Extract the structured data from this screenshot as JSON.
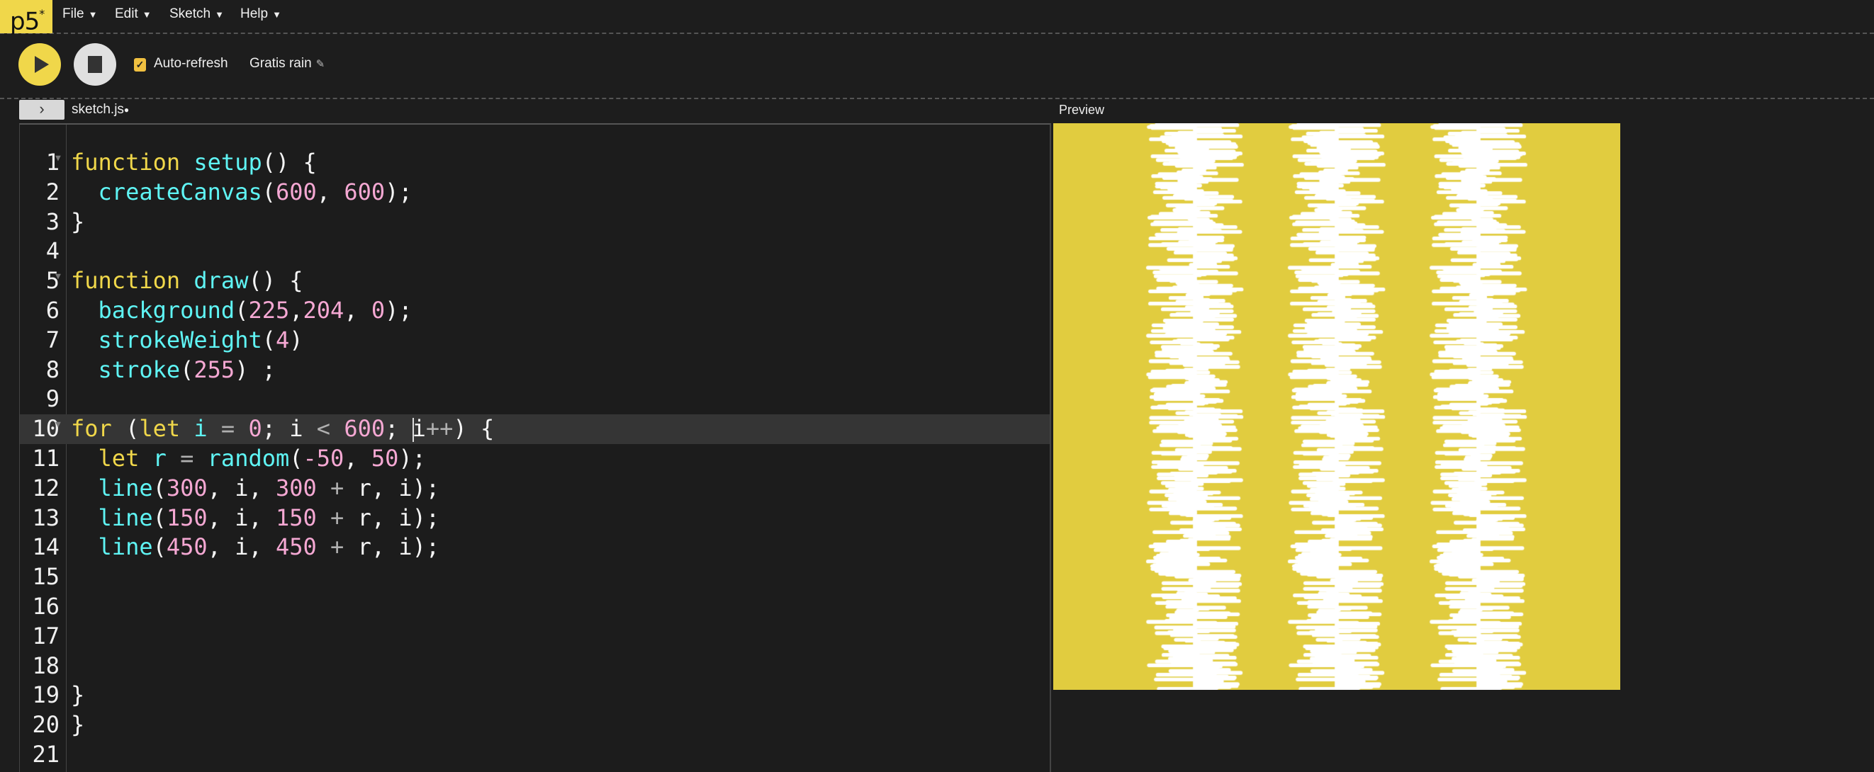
{
  "logo": {
    "text": "p5",
    "sup": "*"
  },
  "menu": [
    {
      "label": "File"
    },
    {
      "label": "Edit"
    },
    {
      "label": "Sketch"
    },
    {
      "label": "Help"
    }
  ],
  "menu_caret": "▼",
  "toolbar": {
    "auto_refresh_label": "Auto-refresh",
    "auto_refresh_checked": true,
    "sketch_name": "Gratis rain",
    "pencil_icon": "✎"
  },
  "editor": {
    "tab_name": "sketch.js",
    "unsaved_dot": "●",
    "active_line": 10,
    "folds": [
      1,
      5,
      10
    ],
    "lines": [
      [
        [
          "kw",
          "function"
        ],
        [
          "plain",
          " "
        ],
        [
          "fn",
          "setup"
        ],
        [
          "plain",
          "() {"
        ]
      ],
      [
        [
          "plain",
          "  "
        ],
        [
          "fn",
          "createCanvas"
        ],
        [
          "plain",
          "("
        ],
        [
          "num",
          "600"
        ],
        [
          "plain",
          ", "
        ],
        [
          "num",
          "600"
        ],
        [
          "plain",
          ");"
        ]
      ],
      [
        [
          "plain",
          "}"
        ]
      ],
      [],
      [
        [
          "kw",
          "function"
        ],
        [
          "plain",
          " "
        ],
        [
          "fn",
          "draw"
        ],
        [
          "plain",
          "() {"
        ]
      ],
      [
        [
          "plain",
          "  "
        ],
        [
          "fn",
          "background"
        ],
        [
          "plain",
          "("
        ],
        [
          "num",
          "225"
        ],
        [
          "plain",
          ","
        ],
        [
          "num",
          "204"
        ],
        [
          "plain",
          ", "
        ],
        [
          "num",
          "0"
        ],
        [
          "plain",
          ");"
        ]
      ],
      [
        [
          "plain",
          "  "
        ],
        [
          "fn",
          "strokeWeight"
        ],
        [
          "plain",
          "("
        ],
        [
          "num",
          "4"
        ],
        [
          "plain",
          ")"
        ]
      ],
      [
        [
          "plain",
          "  "
        ],
        [
          "fn",
          "stroke"
        ],
        [
          "plain",
          "("
        ],
        [
          "num",
          "255"
        ],
        [
          "plain",
          ") ;"
        ]
      ],
      [],
      [
        [
          "kw",
          "for"
        ],
        [
          "plain",
          " ("
        ],
        [
          "kw",
          "let"
        ],
        [
          "plain",
          " "
        ],
        [
          "fn",
          "i"
        ],
        [
          "plain",
          " "
        ],
        [
          "op",
          "="
        ],
        [
          "plain",
          " "
        ],
        [
          "num",
          "0"
        ],
        [
          "plain",
          "; i "
        ],
        [
          "op",
          "<"
        ],
        [
          "plain",
          " "
        ],
        [
          "num",
          "600"
        ],
        [
          "plain",
          "; "
        ],
        [
          "caret",
          ""
        ],
        [
          "plain",
          "i"
        ],
        [
          "op",
          "++"
        ],
        [
          "plain",
          ") {"
        ]
      ],
      [
        [
          "plain",
          "  "
        ],
        [
          "kw",
          "let"
        ],
        [
          "plain",
          " "
        ],
        [
          "fn",
          "r"
        ],
        [
          "plain",
          " "
        ],
        [
          "op",
          "="
        ],
        [
          "plain",
          " "
        ],
        [
          "fn",
          "random"
        ],
        [
          "plain",
          "("
        ],
        [
          "num",
          "-50"
        ],
        [
          "plain",
          ", "
        ],
        [
          "num",
          "50"
        ],
        [
          "plain",
          ");"
        ]
      ],
      [
        [
          "plain",
          "  "
        ],
        [
          "fn",
          "line"
        ],
        [
          "plain",
          "("
        ],
        [
          "num",
          "300"
        ],
        [
          "plain",
          ", i, "
        ],
        [
          "num",
          "300"
        ],
        [
          "plain",
          " "
        ],
        [
          "op",
          "+"
        ],
        [
          "plain",
          " r, i);"
        ]
      ],
      [
        [
          "plain",
          "  "
        ],
        [
          "fn",
          "line"
        ],
        [
          "plain",
          "("
        ],
        [
          "num",
          "150"
        ],
        [
          "plain",
          ", i, "
        ],
        [
          "num",
          "150"
        ],
        [
          "plain",
          " "
        ],
        [
          "op",
          "+"
        ],
        [
          "plain",
          " r, i);"
        ]
      ],
      [
        [
          "plain",
          "  "
        ],
        [
          "fn",
          "line"
        ],
        [
          "plain",
          "("
        ],
        [
          "num",
          "450"
        ],
        [
          "plain",
          ", i, "
        ],
        [
          "num",
          "450"
        ],
        [
          "plain",
          " "
        ],
        [
          "op",
          "+"
        ],
        [
          "plain",
          " r, i);"
        ]
      ],
      [],
      [],
      [],
      [],
      [
        [
          "plain",
          "}"
        ]
      ],
      [
        [
          "plain",
          "}"
        ]
      ],
      []
    ]
  },
  "preview": {
    "label": "Preview",
    "background": "#e1cc3f",
    "stroke": "#ffffff"
  },
  "colors": {
    "accent": "#f0d74a",
    "bg": "#1d1d1d",
    "keyword": "#f0d74a",
    "function": "#5ff4f4",
    "number": "#f5a8d3"
  }
}
